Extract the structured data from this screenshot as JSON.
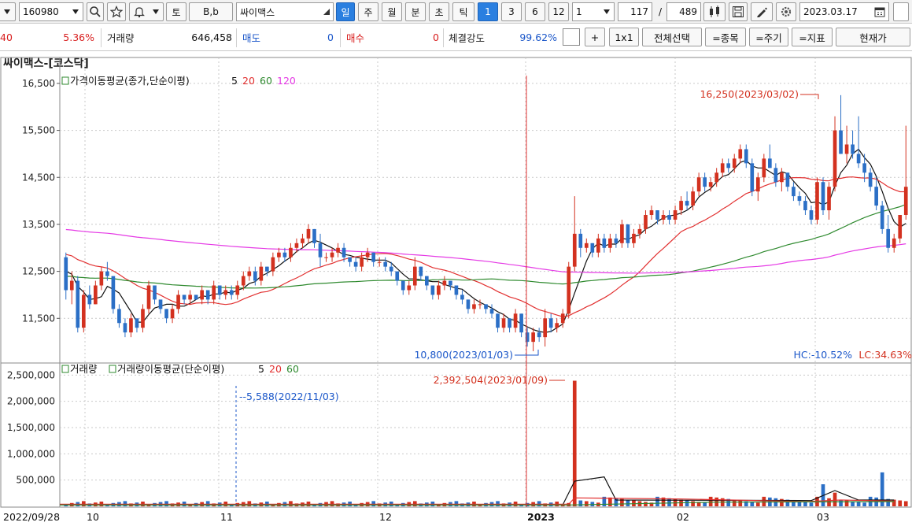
{
  "toolbar": {
    "code": "160980",
    "stock_name": "싸이맥스",
    "bb_label": "B,b",
    "to_label": "토",
    "periods": [
      "일",
      "주",
      "월",
      "분",
      "초",
      "틱"
    ],
    "active_period": "일",
    "quick_nums": [
      "1",
      "3",
      "6",
      "12"
    ],
    "active_num": "1",
    "unit_select": "1",
    "count_value": "117",
    "count_sep": "/",
    "total_value": "489",
    "date_value": "2023.03.17"
  },
  "info": {
    "first_value": "40",
    "change_pct": "5.36%",
    "volume_label": "거래량",
    "volume_value": "646,458",
    "sell_label": "매도",
    "sell_value": "0",
    "buy_label": "매수",
    "buy_value": "0",
    "strength_label": "체결강도",
    "strength_value": "99.62%",
    "plus_label": "+",
    "ratio_label": "1x1",
    "select_all_label": "전체선택",
    "item_label": "=종목",
    "cycle_label": "=주기",
    "indicator_label": "=지표",
    "price_label": "현재가"
  },
  "chart_title": "싸이맥스-[코스닥]",
  "colors": {
    "up": "#d3311f",
    "down": "#2b6fc6",
    "ma5": "#111111",
    "ma20": "#e23030",
    "ma60": "#2f8a2f",
    "ma120": "#e53ae5",
    "accent": "#2a7fe0"
  },
  "chart_data": [
    {
      "type": "candlestick",
      "legend": "가격이동평균(종가,단순이평)",
      "ma_periods": [
        "5",
        "20",
        "60",
        "120"
      ],
      "y_ticks": [
        "16,500",
        "15,500",
        "14,500",
        "13,500",
        "12,500",
        "11,500"
      ],
      "ylim": [
        10600,
        16800
      ],
      "grid": true,
      "annotations": {
        "high": "16,250(2023/03/02)",
        "low": "10,800(2023/01/03)",
        "hc": "HC:-10.52%",
        "lc": "LC:34.63%"
      },
      "candles": [
        [
          12800,
          12900,
          11900,
          12100
        ],
        [
          12100,
          12500,
          11800,
          12300
        ],
        [
          12300,
          12400,
          11200,
          11300
        ],
        [
          11300,
          12100,
          11200,
          12000
        ],
        [
          12000,
          12200,
          11700,
          11800
        ],
        [
          11800,
          12300,
          11800,
          12200
        ],
        [
          12200,
          12600,
          12100,
          12500
        ],
        [
          12500,
          12700,
          12300,
          12400
        ],
        [
          12400,
          12300,
          11600,
          11700
        ],
        [
          11700,
          11800,
          11300,
          11400
        ],
        [
          11400,
          11500,
          11100,
          11200
        ],
        [
          11200,
          11600,
          11100,
          11500
        ],
        [
          11500,
          11400,
          11200,
          11300
        ],
        [
          11300,
          11800,
          11200,
          11700
        ],
        [
          11700,
          12300,
          11600,
          12200
        ],
        [
          12200,
          12200,
          11800,
          11900
        ],
        [
          11900,
          11800,
          11600,
          11700
        ],
        [
          11700,
          11700,
          11400,
          11500
        ],
        [
          11500,
          11800,
          11400,
          11700
        ],
        [
          11700,
          12100,
          11600,
          12000
        ],
        [
          12000,
          12000,
          11800,
          11900
        ],
        [
          11900,
          12100,
          11800,
          12000
        ],
        [
          12000,
          12000,
          11900,
          11900
        ],
        [
          11900,
          12200,
          11800,
          12100
        ],
        [
          12100,
          12100,
          11800,
          11900
        ],
        [
          11900,
          12300,
          11800,
          12200
        ],
        [
          12200,
          12200,
          11900,
          12000
        ],
        [
          12000,
          12200,
          11900,
          12100
        ],
        [
          12100,
          12200,
          11900,
          12000
        ],
        [
          12000,
          12300,
          11900,
          12200
        ],
        [
          12200,
          12500,
          12100,
          12400
        ],
        [
          12400,
          12600,
          12300,
          12500
        ],
        [
          12500,
          12600,
          12200,
          12300
        ],
        [
          12300,
          12700,
          12200,
          12600
        ],
        [
          12600,
          12600,
          12400,
          12500
        ],
        [
          12500,
          12900,
          12400,
          12800
        ],
        [
          12800,
          13000,
          12700,
          12900
        ],
        [
          12900,
          13000,
          12700,
          12800
        ],
        [
          12800,
          13100,
          12700,
          13000
        ],
        [
          13000,
          13200,
          12900,
          13100
        ],
        [
          13100,
          13300,
          13000,
          13200
        ],
        [
          13200,
          13500,
          13100,
          13400
        ],
        [
          13400,
          13400,
          13000,
          13100
        ],
        [
          13100,
          13300,
          12600,
          12800
        ],
        [
          12800,
          12900,
          12700,
          12800
        ],
        [
          12800,
          13000,
          12700,
          12900
        ],
        [
          12900,
          13100,
          12800,
          13000
        ],
        [
          13000,
          13100,
          12700,
          12800
        ],
        [
          12800,
          12800,
          12600,
          12700
        ],
        [
          12700,
          12800,
          12500,
          12600
        ],
        [
          12600,
          12900,
          12500,
          12800
        ],
        [
          12800,
          13000,
          12700,
          12900
        ],
        [
          12900,
          12900,
          12600,
          12700
        ],
        [
          12700,
          12800,
          12600,
          12700
        ],
        [
          12700,
          12800,
          12500,
          12600
        ],
        [
          12600,
          12700,
          12400,
          12500
        ],
        [
          12500,
          12500,
          12200,
          12300
        ],
        [
          12300,
          12300,
          12000,
          12100
        ],
        [
          12100,
          12300,
          12000,
          12200
        ],
        [
          12200,
          12800,
          12100,
          12600
        ],
        [
          12600,
          12600,
          12300,
          12400
        ],
        [
          12400,
          12400,
          12100,
          12200
        ],
        [
          12200,
          12200,
          11900,
          12000
        ],
        [
          12000,
          12300,
          11900,
          12200
        ],
        [
          12200,
          12400,
          12100,
          12300
        ],
        [
          12300,
          12300,
          12100,
          12200
        ],
        [
          12200,
          12200,
          11900,
          12000
        ],
        [
          12000,
          12100,
          11800,
          11900
        ],
        [
          11900,
          11900,
          11600,
          11700
        ],
        [
          11700,
          11900,
          11600,
          11800
        ],
        [
          11800,
          11900,
          11700,
          11800
        ],
        [
          11800,
          11800,
          11600,
          11700
        ],
        [
          11700,
          11800,
          11500,
          11600
        ],
        [
          11600,
          11600,
          11200,
          11300
        ],
        [
          11300,
          11600,
          11200,
          11500
        ],
        [
          11500,
          11500,
          11200,
          11300
        ],
        [
          11300,
          11700,
          11200,
          11600
        ],
        [
          11600,
          11600,
          11100,
          11200
        ],
        [
          11200,
          11300,
          10900,
          11000
        ],
        [
          11000,
          11300,
          10800,
          11200
        ],
        [
          11200,
          11300,
          11000,
          11100
        ],
        [
          11100,
          11700,
          10900,
          11500
        ],
        [
          11500,
          11600,
          11200,
          11300
        ],
        [
          11300,
          11500,
          11200,
          11400
        ],
        [
          11400,
          11700,
          11300,
          11600
        ],
        [
          11600,
          12700,
          11500,
          12600
        ],
        [
          12600,
          14100,
          12500,
          13300
        ],
        [
          13300,
          13400,
          12800,
          13000
        ],
        [
          13000,
          13200,
          12900,
          13100
        ],
        [
          13100,
          13100,
          12800,
          12900
        ],
        [
          12900,
          13300,
          12800,
          13200
        ],
        [
          13200,
          13300,
          12900,
          13000
        ],
        [
          13000,
          13300,
          12900,
          13200
        ],
        [
          13200,
          13300,
          13000,
          13100
        ],
        [
          13100,
          13600,
          13000,
          13500
        ],
        [
          13500,
          13500,
          13000,
          13100
        ],
        [
          13100,
          13400,
          13000,
          13300
        ],
        [
          13300,
          13500,
          13200,
          13400
        ],
        [
          13400,
          13800,
          13300,
          13700
        ],
        [
          13700,
          13900,
          13600,
          13800
        ],
        [
          13800,
          13800,
          13500,
          13600
        ],
        [
          13600,
          13800,
          13500,
          13700
        ],
        [
          13700,
          13800,
          13500,
          13600
        ],
        [
          13600,
          13900,
          13500,
          13800
        ],
        [
          13800,
          14100,
          13700,
          14000
        ],
        [
          14000,
          14200,
          13800,
          13900
        ],
        [
          13900,
          14300,
          13800,
          14200
        ],
        [
          14200,
          14600,
          14100,
          14500
        ],
        [
          14500,
          14600,
          14200,
          14300
        ],
        [
          14300,
          14500,
          14200,
          14400
        ],
        [
          14400,
          14700,
          14300,
          14600
        ],
        [
          14600,
          14900,
          14500,
          14800
        ],
        [
          14800,
          14900,
          14600,
          14700
        ],
        [
          14700,
          15000,
          14600,
          14900
        ],
        [
          14900,
          15200,
          14800,
          15100
        ],
        [
          15100,
          15200,
          14700,
          14800
        ],
        [
          14800,
          14900,
          14100,
          14200
        ],
        [
          14200,
          14600,
          14000,
          14500
        ],
        [
          14500,
          15000,
          14400,
          14900
        ],
        [
          14900,
          15200,
          14700,
          14700
        ],
        [
          14700,
          14800,
          14300,
          14400
        ],
        [
          14400,
          14700,
          14200,
          14600
        ],
        [
          14600,
          14600,
          14200,
          14300
        ],
        [
          14300,
          14400,
          14000,
          14100
        ],
        [
          14100,
          14200,
          13900,
          14000
        ],
        [
          14000,
          14100,
          13700,
          13800
        ],
        [
          13800,
          13900,
          13500,
          13600
        ],
        [
          13600,
          14500,
          13500,
          14400
        ],
        [
          14400,
          14500,
          13700,
          13800
        ],
        [
          13800,
          14400,
          13600,
          14300
        ],
        [
          14300,
          15800,
          14200,
          15500
        ],
        [
          15500,
          16250,
          15000,
          15000
        ],
        [
          15000,
          15600,
          14800,
          15200
        ],
        [
          15200,
          15500,
          14900,
          15000
        ],
        [
          15000,
          15800,
          14700,
          14800
        ],
        [
          14800,
          15000,
          14400,
          14600
        ],
        [
          14600,
          14700,
          14200,
          14300
        ],
        [
          14300,
          14500,
          13800,
          13900
        ],
        [
          13900,
          14000,
          13300,
          13400
        ],
        [
          13400,
          13700,
          12900,
          13000
        ],
        [
          13000,
          13300,
          12900,
          13200
        ],
        [
          13200,
          13700,
          13100,
          13700
        ],
        [
          13700,
          15600,
          13600,
          14300
        ]
      ]
    },
    {
      "type": "bar",
      "legend_a": "거래량",
      "legend_b": "거래량이동평균(단순이평)",
      "ma_periods": [
        "5",
        "20",
        "60"
      ],
      "y_ticks": [
        "2,500,000",
        "2,000,000",
        "1,500,000",
        "1,000,000",
        "500,000"
      ],
      "ylim": [
        0,
        2700000
      ],
      "grid": true,
      "x_ticks": [
        "2022/09/28",
        "10",
        "11",
        "12",
        "2023",
        "02",
        "03"
      ],
      "annotations": {
        "max": "2,392,504(2023/01/09)",
        "min": "5,588(2022/11/03)"
      }
    }
  ]
}
